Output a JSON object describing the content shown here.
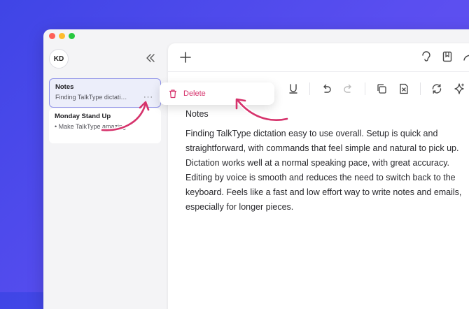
{
  "user": {
    "initials": "KD"
  },
  "sidebar": {
    "notes": [
      {
        "title": "Notes",
        "snippet": "Finding TalkType dictati…",
        "active": true
      },
      {
        "title": "Monday Stand Up",
        "snippet": "• Make TalkType amazing",
        "active": false
      }
    ],
    "more_label": "···"
  },
  "context_menu": {
    "delete_label": "Delete"
  },
  "document": {
    "title": "Notes",
    "body": "Finding TalkType dictation easy to use overall. Setup is quick and straightforward, with commands that feel simple and natural to pick up. Dictation works well at a normal speaking pace, with great accuracy. Editing by voice is smooth and reduces the need to switch back to the keyboard. Feels like a fast and low effort way to write notes and emails, especially for longer pieces."
  },
  "colors": {
    "accent": "#d6336c",
    "active_border": "#8e92e8",
    "background_gradient_start": "#3f45e6",
    "background_gradient_end": "#6a55f2"
  },
  "icons": {
    "toolbar": [
      "underline-icon",
      "undo-icon",
      "redo-icon",
      "copy-icon",
      "clear-format-icon",
      "refresh-icon",
      "sparkle-icon"
    ],
    "top_right": [
      "voice-icon",
      "bookmark-icon",
      "forward-icon"
    ]
  }
}
